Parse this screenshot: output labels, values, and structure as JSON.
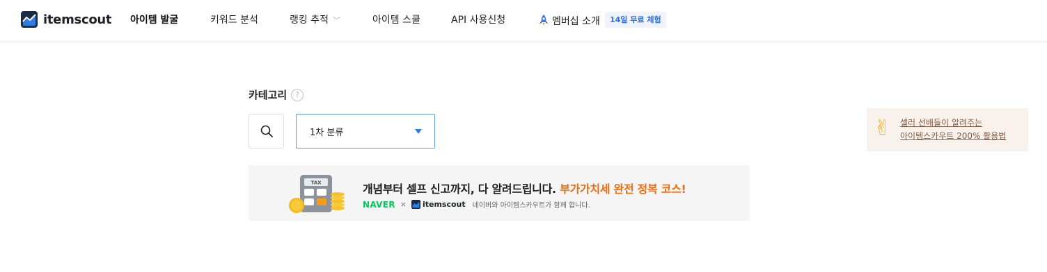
{
  "header": {
    "logo_text": "itemscout",
    "nav": [
      {
        "label": "아이템 발굴"
      },
      {
        "label": "키워드 분석"
      },
      {
        "label": "랭킹 추적"
      },
      {
        "label": "아이템 스쿨"
      },
      {
        "label": "API 사용신청"
      },
      {
        "label": "멤버십 소개"
      }
    ],
    "trial_badge": "14일 무료 체험"
  },
  "category": {
    "title": "카테고리",
    "help": "?",
    "select_value": "1차 분류"
  },
  "guide": {
    "line1": "셀러 선배들이 알려주는",
    "line2": "아이템스카우트 200% 활용법"
  },
  "banner": {
    "headline_main": "개념부터 셀프 신고까지, 다 알려드립니다. ",
    "headline_highlight": "부가가치세 완전 정복 코스!",
    "partner1": "NAVER",
    "times": "×",
    "partner2": "itemscout",
    "note": "네이버와 아이템스카우트가 함께 합니다.",
    "tax_label": "TAX"
  },
  "colors": {
    "brand_blue": "#2f7fe3",
    "highlight_orange": "#ef6c0f",
    "naver_green": "#03c75a"
  }
}
